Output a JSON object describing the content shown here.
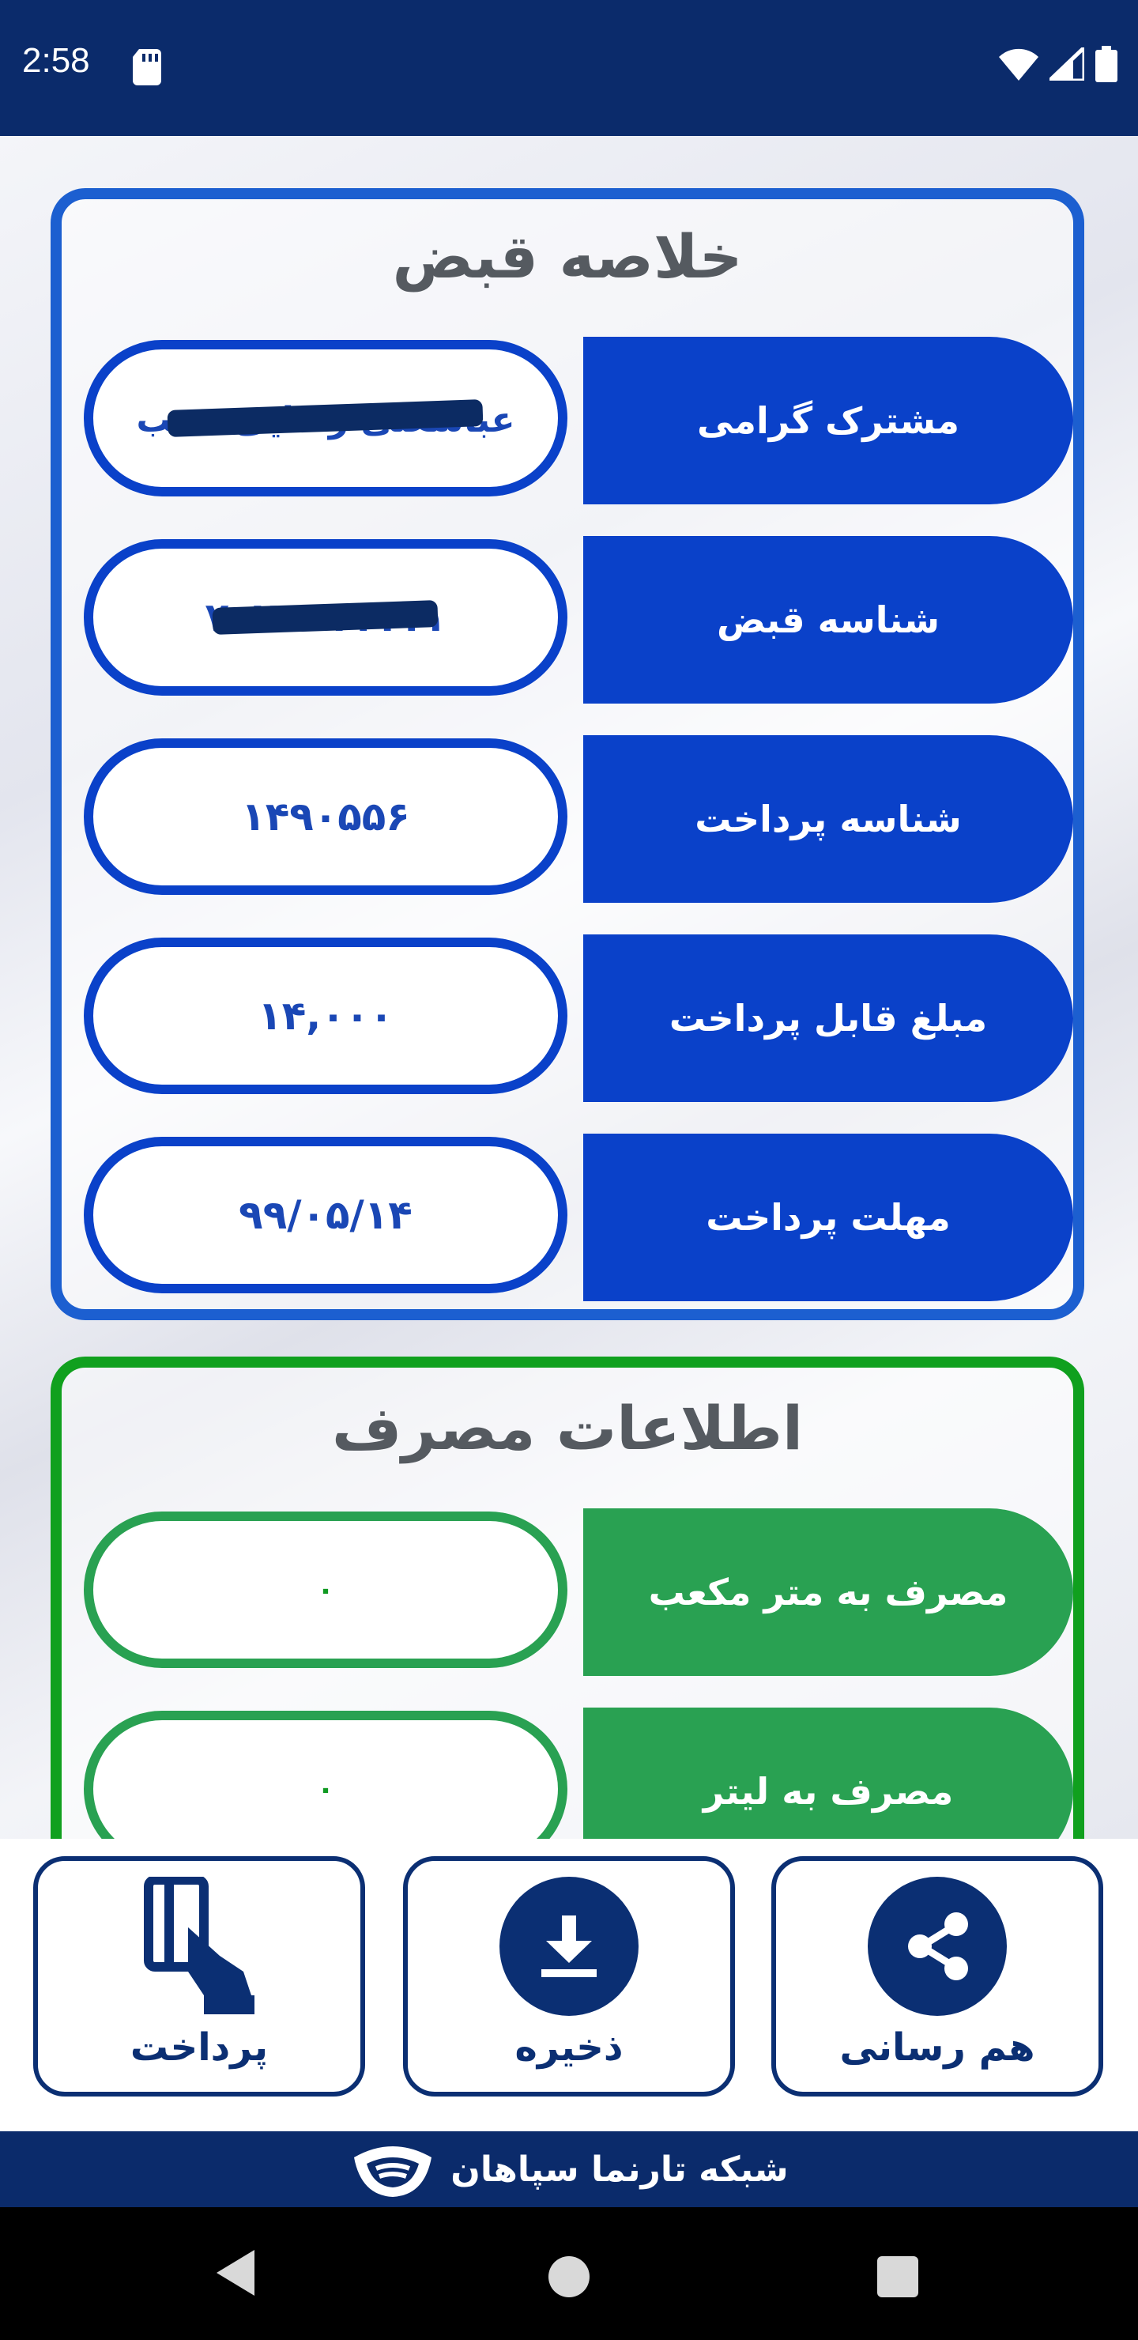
{
  "status_bar": {
    "time": "2:58"
  },
  "bill_summary": {
    "title": "خلاصه قبض",
    "rows": [
      {
        "label": "مشترک گرامی",
        "value": "عباسعلی رضایی نسب",
        "redacted": true
      },
      {
        "label": "شناسه قبض",
        "value": "۷۰۲۱۱۱۱۱۱۱",
        "redacted": true
      },
      {
        "label": "شناسه پرداخت",
        "value": "۱۴۹۰۵۵۶",
        "redacted": false
      },
      {
        "label": "مبلغ قابل پرداخت",
        "value": "۱۴,۰۰۰",
        "redacted": false
      },
      {
        "label": "مهلت پرداخت",
        "value": "۹۹/۰۵/۱۴",
        "redacted": false
      }
    ]
  },
  "usage_info": {
    "title": "اطلاعات مصرف",
    "rows": [
      {
        "label": "مصرف به متر مکعب",
        "value": "۰"
      },
      {
        "label": "مصرف به لیتر",
        "value": "۰"
      }
    ]
  },
  "actions": {
    "share": {
      "label": "هم رسانی",
      "icon": "share-icon"
    },
    "save": {
      "label": "ذخیره",
      "icon": "download-icon"
    },
    "pay": {
      "label": "پرداخت",
      "icon": "card-payment-icon"
    }
  },
  "footer": {
    "text": "شبکه تارنما سپاهان"
  },
  "colors": {
    "primary_blue": "#0a41c9",
    "usage_green": "#29a152",
    "navy": "#0b2b6b"
  }
}
